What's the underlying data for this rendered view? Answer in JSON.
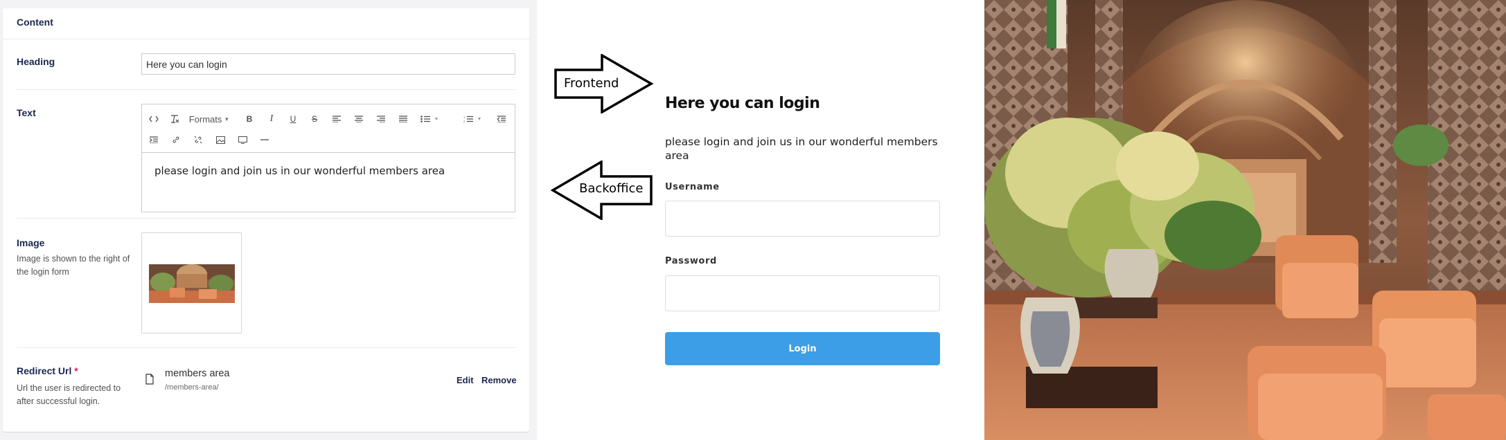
{
  "backoffice": {
    "section_title": "Content",
    "heading": {
      "label": "Heading",
      "value": "Here you can login"
    },
    "text": {
      "label": "Text",
      "toolbar": {
        "formats_label": "Formats"
      },
      "content": "please login and join us in our wonderful members area"
    },
    "image": {
      "label": "Image",
      "description": "Image is shown to the right of the login form"
    },
    "redirect": {
      "label": "Redirect Url",
      "required_mark": "*",
      "description": "Url the user is redirected to after successful login.",
      "link_name": "members area",
      "link_url": "/members-area/",
      "edit_label": "Edit",
      "remove_label": "Remove"
    }
  },
  "annotations": {
    "frontend_label": "Frontend",
    "backoffice_label": "Backoffice"
  },
  "frontend": {
    "title": "Here you can login",
    "text": "please login and join us in our wonderful members area",
    "username_label": "Username",
    "password_label": "Password",
    "login_button": "Login"
  },
  "colors": {
    "accent_blue": "#3c9ee6",
    "navy_text": "#1b264f",
    "required_red": "#d42054"
  }
}
